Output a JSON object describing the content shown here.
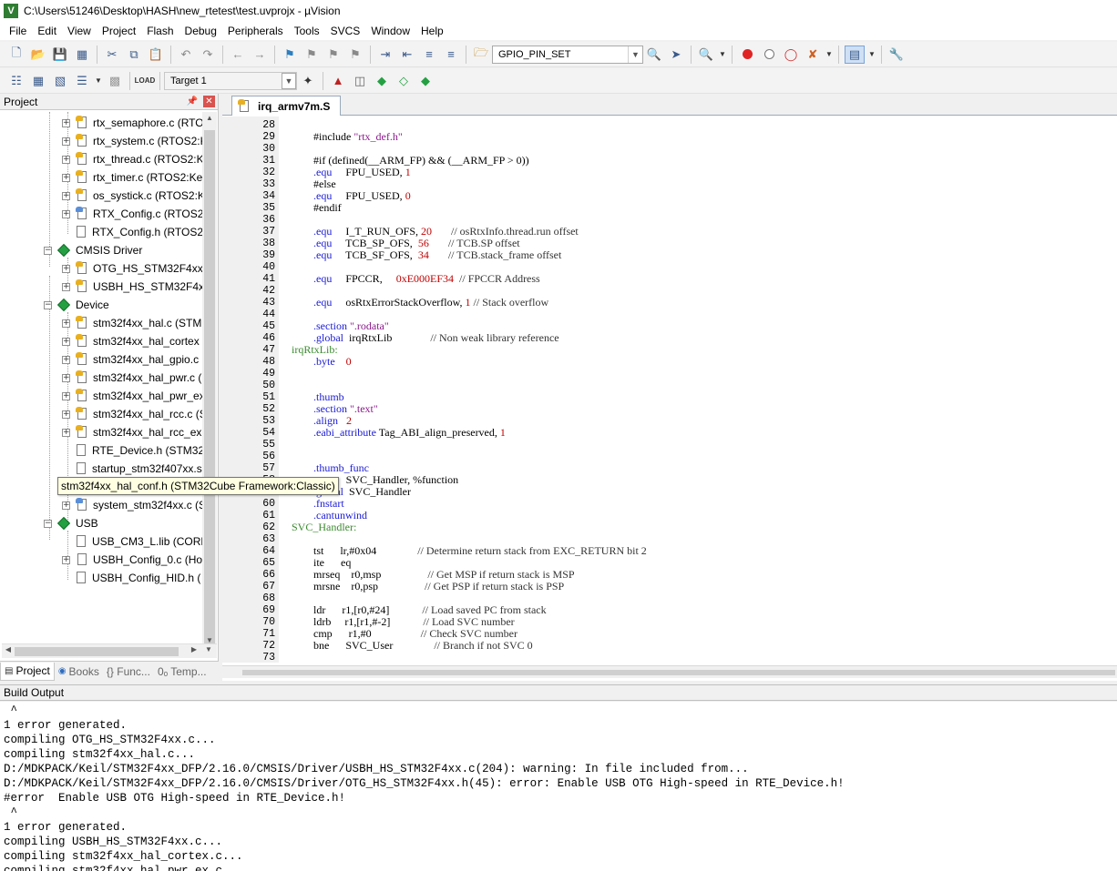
{
  "window": {
    "title": "C:\\Users\\51246\\Desktop\\HASH\\new_rtetest\\test.uvprojx - µVision"
  },
  "menu": [
    "File",
    "Edit",
    "View",
    "Project",
    "Flash",
    "Debug",
    "Peripherals",
    "Tools",
    "SVCS",
    "Window",
    "Help"
  ],
  "toolbar": {
    "find_combo": "GPIO_PIN_SET",
    "target_combo": "Target 1"
  },
  "project_panel": {
    "title": "Project",
    "tree": [
      {
        "label": "rtx_semaphore.c (RTO",
        "kind": "file"
      },
      {
        "label": "rtx_system.c (RTOS2:K",
        "kind": "file"
      },
      {
        "label": "rtx_thread.c (RTOS2:Ke",
        "kind": "file"
      },
      {
        "label": "rtx_timer.c (RTOS2:Kei",
        "kind": "file"
      },
      {
        "label": "os_systick.c (RTOS2:Ke",
        "kind": "file"
      },
      {
        "label": "RTX_Config.c (RTOS2:I",
        "kind": "file"
      },
      {
        "label": "RTX_Config.h (RTOS2:I",
        "kind": "file"
      },
      {
        "label": "CMSIS Driver",
        "kind": "group"
      },
      {
        "label": "OTG_HS_STM32F4xx.c",
        "kind": "file"
      },
      {
        "label": "USBH_HS_STM32F4xx",
        "kind": "file"
      },
      {
        "label": "Device",
        "kind": "group"
      },
      {
        "label": "stm32f4xx_hal.c (STM",
        "kind": "file"
      },
      {
        "label": "stm32f4xx_hal_cortex",
        "kind": "file"
      },
      {
        "label": "stm32f4xx_hal_gpio.c",
        "kind": "file"
      },
      {
        "label": "stm32f4xx_hal_pwr.c (",
        "kind": "file"
      },
      {
        "label": "stm32f4xx_hal_pwr_ex",
        "kind": "file"
      },
      {
        "label": "stm32f4xx_hal_rcc.c (S",
        "kind": "file"
      },
      {
        "label": "stm32f4xx_hal_rcc_ex",
        "kind": "file"
      },
      {
        "label": "RTE_Device.h (STM32C",
        "kind": "file"
      },
      {
        "label": "startup_stm32f407xx.s",
        "kind": "file"
      },
      {
        "label": "",
        "kind": "file"
      },
      {
        "label": "system_stm32f4xx.c (S",
        "kind": "file"
      },
      {
        "label": "USB",
        "kind": "group"
      },
      {
        "label": "USB_CM3_L.lib (CORE",
        "kind": "file"
      },
      {
        "label": "USBH_Config_0.c (Ho",
        "kind": "file"
      },
      {
        "label": "USBH_Config_HID.h (",
        "kind": "file"
      }
    ],
    "tooltip": "stm32f4xx_hal_conf.h (STM32Cube Framework:Classic)",
    "tabs": [
      "Project",
      "Books",
      "{} Func...",
      "0ₒ Temp..."
    ]
  },
  "editor": {
    "tab": "irq_armv7m.S",
    "lines": [
      {
        "n": "28",
        "t": ""
      },
      {
        "n": "29",
        "t": "        #include \"rtx_def.h\""
      },
      {
        "n": "30",
        "t": ""
      },
      {
        "n": "31",
        "t": "        #if (defined(__ARM_FP) && (__ARM_FP > 0))"
      },
      {
        "n": "32",
        "t": "        .equ     FPU_USED, 1"
      },
      {
        "n": "33",
        "t": "        #else"
      },
      {
        "n": "34",
        "t": "        .equ     FPU_USED, 0"
      },
      {
        "n": "35",
        "t": "        #endif"
      },
      {
        "n": "36",
        "t": ""
      },
      {
        "n": "37",
        "t": "        .equ     I_T_RUN_OFS, 20       // osRtxInfo.thread.run offset"
      },
      {
        "n": "38",
        "t": "        .equ     TCB_SP_OFS,  56       // TCB.SP offset"
      },
      {
        "n": "39",
        "t": "        .equ     TCB_SF_OFS,  34       // TCB.stack_frame offset"
      },
      {
        "n": "40",
        "t": ""
      },
      {
        "n": "41",
        "t": "        .equ     FPCCR,     0xE000EF34  // FPCCR Address"
      },
      {
        "n": "42",
        "t": ""
      },
      {
        "n": "43",
        "t": "        .equ     osRtxErrorStackOverflow, 1 // Stack overflow"
      },
      {
        "n": "44",
        "t": ""
      },
      {
        "n": "45",
        "t": "        .section \".rodata\""
      },
      {
        "n": "46",
        "t": "        .global  irqRtxLib              // Non weak library reference"
      },
      {
        "n": "47",
        "t": "irqRtxLib:"
      },
      {
        "n": "48",
        "t": "        .byte    0"
      },
      {
        "n": "49",
        "t": ""
      },
      {
        "n": "50",
        "t": ""
      },
      {
        "n": "51",
        "t": "        .thumb"
      },
      {
        "n": "52",
        "t": "        .section \".text\""
      },
      {
        "n": "53",
        "t": "        .align   2"
      },
      {
        "n": "54",
        "t": "        .eabi_attribute Tag_ABI_align_preserved, 1"
      },
      {
        "n": "55",
        "t": ""
      },
      {
        "n": "56",
        "t": ""
      },
      {
        "n": "57",
        "t": "        .thumb_func"
      },
      {
        "n": "58",
        "t": "        .type    SVC_Handler, %function"
      },
      {
        "n": "59",
        "t": "        .global  SVC_Handler"
      },
      {
        "n": "60",
        "t": "        .fnstart"
      },
      {
        "n": "61",
        "t": "        .cantunwind"
      },
      {
        "n": "62",
        "t": "SVC_Handler:"
      },
      {
        "n": "63",
        "t": ""
      },
      {
        "n": "64",
        "t": "        tst      lr,#0x04               // Determine return stack from EXC_RETURN bit 2"
      },
      {
        "n": "65",
        "t": "        ite      eq"
      },
      {
        "n": "66",
        "t": "        mrseq    r0,msp                 // Get MSP if return stack is MSP"
      },
      {
        "n": "67",
        "t": "        mrsne    r0,psp                 // Get PSP if return stack is PSP"
      },
      {
        "n": "68",
        "t": ""
      },
      {
        "n": "69",
        "t": "        ldr      r1,[r0,#24]            // Load saved PC from stack"
      },
      {
        "n": "70",
        "t": "        ldrb     r1,[r1,#-2]            // Load SVC number"
      },
      {
        "n": "71",
        "t": "        cmp      r1,#0                  // Check SVC number"
      },
      {
        "n": "72",
        "t": "        bne      SVC_User               // Branch if not SVC 0"
      },
      {
        "n": "73",
        "t": ""
      }
    ]
  },
  "build_output": {
    "title": "Build Output",
    "lines": [
      " ^",
      "1 error generated.",
      "compiling OTG_HS_STM32F4xx.c...",
      "compiling stm32f4xx_hal.c...",
      "D:/MDKPACK/Keil/STM32F4xx_DFP/2.16.0/CMSIS/Driver/USBH_HS_STM32F4xx.c(204): warning: In file included from...",
      "D:/MDKPACK/Keil/STM32F4xx_DFP/2.16.0/CMSIS/Driver/OTG_HS_STM32F4xx.h(45): error: Enable USB OTG High-speed in RTE_Device.h!",
      "#error  Enable USB OTG High-speed in RTE_Device.h!",
      " ^",
      "1 error generated.",
      "compiling USBH_HS_STM32F4xx.c...",
      "compiling stm32f4xx_hal_cortex.c...",
      "compiling stm32f4xx_hal_pwr_ex.c..."
    ]
  }
}
